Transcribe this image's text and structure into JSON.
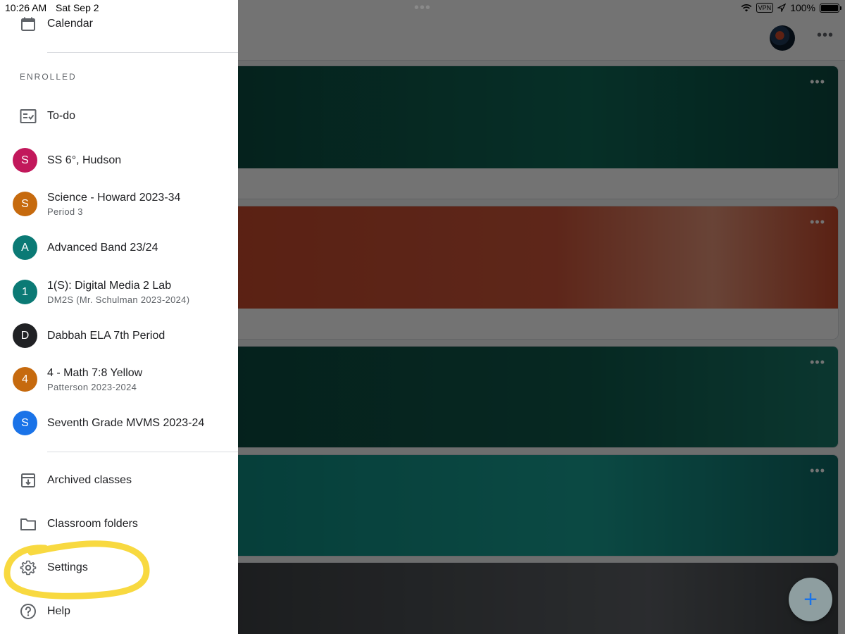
{
  "status_bar": {
    "time": "10:26 AM",
    "date": "Sat Sep 2",
    "vpn": "VPN",
    "battery": "100%",
    "battery_level": 1.0,
    "dots": "•••"
  },
  "drawer": {
    "calendar_label": "Calendar",
    "section_enrolled": "ENROLLED",
    "todo_label": "To-do",
    "classes": [
      {
        "initial": "S",
        "name": "SS 6°, Hudson",
        "sub": "",
        "color": "#c2185b"
      },
      {
        "initial": "S",
        "name": "Science - Howard 2023-34",
        "sub": "Period 3",
        "color": "#c66a0e"
      },
      {
        "initial": "A",
        "name": "Advanced Band 23/24",
        "sub": "",
        "color": "#0b7a75"
      },
      {
        "initial": "1",
        "name": "1(S): Digital Media 2 Lab",
        "sub": "DM2S (Mr. Schulman 2023-2024)",
        "color": "#0b7a75"
      },
      {
        "initial": "D",
        "name": "Dabbah ELA 7th Period",
        "sub": "",
        "color": "#202124"
      },
      {
        "initial": "4",
        "name": "4 - Math 7:8 Yellow",
        "sub": "Patterson 2023-2024",
        "color": "#c66a0e"
      },
      {
        "initial": "S",
        "name": "Seventh Grade MVMS 2023-24",
        "sub": "",
        "color": "#1a73e8"
      }
    ],
    "archived_label": "Archived classes",
    "folders_label": "Classroom folders",
    "settings_label": "Settings",
    "help_label": "Help"
  },
  "background": {
    "card_more": "•••",
    "fab": "+"
  },
  "colors": {
    "highlight": "#f7d21e",
    "fab_icon": "#1a73e8"
  },
  "icons": [
    "calendar-icon",
    "todo-icon",
    "archive-icon",
    "folder-icon",
    "gear-icon",
    "help-icon",
    "wifi-icon",
    "battery-icon",
    "plus-icon",
    "more-icon"
  ]
}
